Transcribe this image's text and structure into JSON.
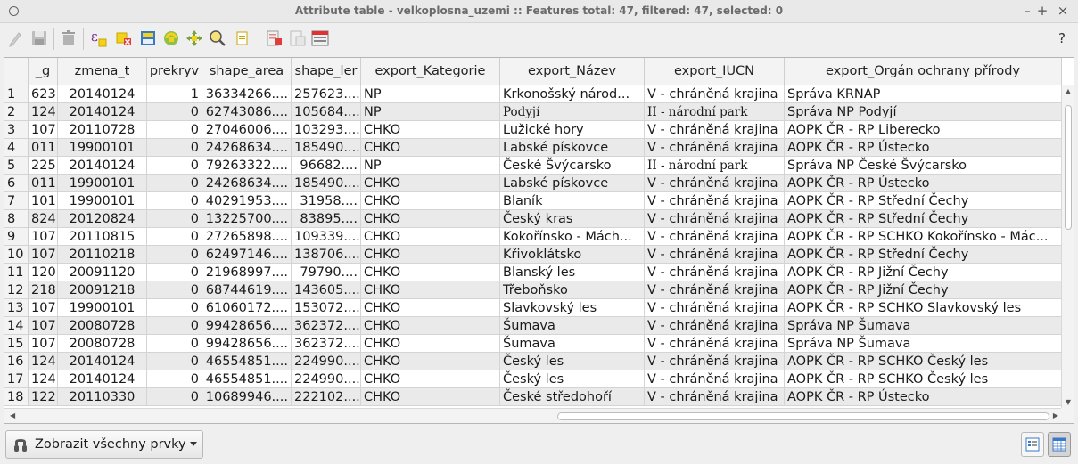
{
  "window": {
    "title": "Attribute table - velkoplosna_uzemi :: Features total: 47, filtered: 47, selected: 0",
    "controls": {
      "minimize": "–",
      "maximize": "+",
      "close": "×"
    }
  },
  "toolbar": {
    "tools": [
      "pencil-icon",
      "save-icon",
      "delete-icon",
      "expression-select-icon",
      "deselect-icon",
      "move-selection-top-icon",
      "invert-selection-icon",
      "pan-to-selection-icon",
      "zoom-to-selection-icon",
      "copy-icon",
      "delete-field-icon",
      "new-field-icon",
      "field-calculator-icon"
    ],
    "help": "?"
  },
  "table": {
    "columns": [
      "_g",
      "zmena_t",
      "prekryv",
      "shape_area",
      "shape_ler",
      "export_Kategorie",
      "export_Název",
      "export_IUCN",
      "export_Orgán ochrany přírody"
    ],
    "rows": [
      {
        "n": "1",
        "g": "623",
        "zmena_t": "20140124",
        "prekryv": "1",
        "area": "36334266....",
        "len": "257623....",
        "kat": "NP",
        "nazev": "Krkonošský národ...",
        "iucn": "V - chráněná krajina",
        "organ": "Správa KRNAP"
      },
      {
        "n": "2",
        "g": "124",
        "zmena_t": "20140124",
        "prekryv": "0",
        "area": "62743086....",
        "len": "105684....",
        "kat": "NP",
        "nazev": "Podyjí",
        "iucn": "II - národní park",
        "organ": "Správa NP Podyjí"
      },
      {
        "n": "3",
        "g": "107",
        "zmena_t": "20110728",
        "prekryv": "0",
        "area": "27046006....",
        "len": "103293....",
        "kat": "CHKO",
        "nazev": "Lužické hory",
        "iucn": "V - chráněná krajina",
        "organ": "AOPK ČR - RP Liberecko"
      },
      {
        "n": "4",
        "g": "011",
        "zmena_t": "19900101",
        "prekryv": "0",
        "area": "24268634....",
        "len": "185490....",
        "kat": "CHKO",
        "nazev": "Labské pískovce",
        "iucn": "V - chráněná krajina",
        "organ": "AOPK ČR - RP Ústecko"
      },
      {
        "n": "5",
        "g": "225",
        "zmena_t": "20140124",
        "prekryv": "0",
        "area": "79263322....",
        "len": "96682....",
        "kat": "NP",
        "nazev": "České Švýcarsko",
        "iucn": "II - národní park",
        "organ": "Správa NP České Švýcarsko"
      },
      {
        "n": "6",
        "g": "011",
        "zmena_t": "19900101",
        "prekryv": "0",
        "area": "24268634....",
        "len": "185490....",
        "kat": "CHKO",
        "nazev": "Labské pískovce",
        "iucn": "V - chráněná krajina",
        "organ": "AOPK ČR - RP Ústecko"
      },
      {
        "n": "7",
        "g": "101",
        "zmena_t": "19900101",
        "prekryv": "0",
        "area": "40291953....",
        "len": "31958....",
        "kat": "CHKO",
        "nazev": "Blaník",
        "iucn": "V - chráněná krajina",
        "organ": "AOPK ČR - RP Střední Čechy"
      },
      {
        "n": "8",
        "g": "824",
        "zmena_t": "20120824",
        "prekryv": "0",
        "area": "13225700....",
        "len": "83895....",
        "kat": "CHKO",
        "nazev": "Český kras",
        "iucn": "V - chráněná krajina",
        "organ": "AOPK ČR - RP Střední Čechy"
      },
      {
        "n": "9",
        "g": "107",
        "zmena_t": "20110815",
        "prekryv": "0",
        "area": "27265898....",
        "len": "109339....",
        "kat": "CHKO",
        "nazev": "Kokořínsko - Mách...",
        "iucn": "V - chráněná krajina",
        "organ": "AOPK ČR - RP SCHKO Kokořínsko - Mác..."
      },
      {
        "n": "10",
        "g": "107",
        "zmena_t": "20110218",
        "prekryv": "0",
        "area": "62497146....",
        "len": "138706....",
        "kat": "CHKO",
        "nazev": "Křivoklátsko",
        "iucn": "V - chráněná krajina",
        "organ": "AOPK ČR - RP Střední Čechy"
      },
      {
        "n": "11",
        "g": "120",
        "zmena_t": "20091120",
        "prekryv": "0",
        "area": "21968997....",
        "len": "79790....",
        "kat": "CHKO",
        "nazev": "Blanský les",
        "iucn": "V - chráněná krajina",
        "organ": "AOPK ČR - RP Jižní Čechy"
      },
      {
        "n": "12",
        "g": "218",
        "zmena_t": "20091218",
        "prekryv": "0",
        "area": "68744619....",
        "len": "143605....",
        "kat": "CHKO",
        "nazev": "Třeboňsko",
        "iucn": "V - chráněná krajina",
        "organ": "AOPK ČR - RP Jižní Čechy"
      },
      {
        "n": "13",
        "g": "107",
        "zmena_t": "19900101",
        "prekryv": "0",
        "area": "61060172....",
        "len": "153072....",
        "kat": "CHKO",
        "nazev": "Slavkovský les",
        "iucn": "V - chráněná krajina",
        "organ": "AOPK ČR - RP SCHKO Slavkovský les"
      },
      {
        "n": "14",
        "g": "107",
        "zmena_t": "20080728",
        "prekryv": "0",
        "area": "99428656....",
        "len": "362372....",
        "kat": "CHKO",
        "nazev": "Šumava",
        "iucn": "V - chráněná krajina",
        "organ": "Správa NP Šumava"
      },
      {
        "n": "15",
        "g": "107",
        "zmena_t": "20080728",
        "prekryv": "0",
        "area": "99428656....",
        "len": "362372....",
        "kat": "CHKO",
        "nazev": "Šumava",
        "iucn": "V - chráněná krajina",
        "organ": "Správa NP Šumava"
      },
      {
        "n": "16",
        "g": "124",
        "zmena_t": "20140124",
        "prekryv": "0",
        "area": "46554851....",
        "len": "224990....",
        "kat": "CHKO",
        "nazev": "Český les",
        "iucn": "V - chráněná krajina",
        "organ": "AOPK ČR - RP SCHKO Český les"
      },
      {
        "n": "17",
        "g": "124",
        "zmena_t": "20140124",
        "prekryv": "0",
        "area": "46554851....",
        "len": "224990....",
        "kat": "CHKO",
        "nazev": "Český les",
        "iucn": "V - chráněná krajina",
        "organ": "AOPK ČR - RP SCHKO Český les"
      },
      {
        "n": "18",
        "g": "122",
        "zmena_t": "20110330",
        "prekryv": "0",
        "area": "10689946....",
        "len": "222102....",
        "kat": "CHKO",
        "nazev": "České středohoří",
        "iucn": "V - chráněná krajina",
        "organ": "AOPK ČR - RP Ústecko"
      }
    ]
  },
  "bottom": {
    "filter_label": "Zobrazit všechny prvky",
    "view_form": "form-view-icon",
    "view_table": "table-view-icon"
  }
}
